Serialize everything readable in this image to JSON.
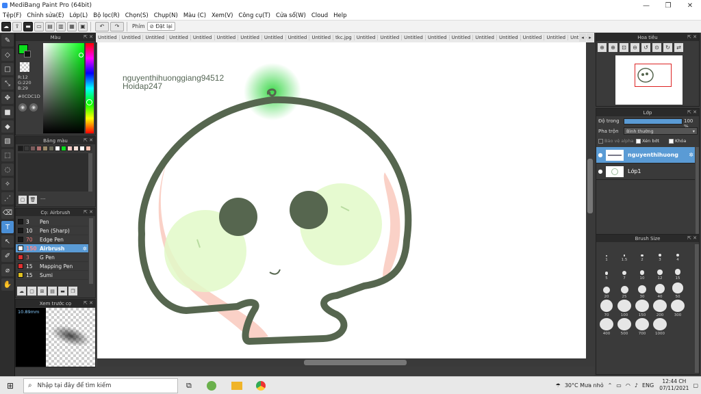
{
  "window": {
    "title": "MediBang Paint Pro (64bit)",
    "minimize": "—",
    "maximize": "❐",
    "close": "✕"
  },
  "menu": [
    "Tệp(F)",
    "Chỉnh sửa(E)",
    "Lớp(L)",
    "Bộ lọc(R)",
    "Chọn(S)",
    "Chụp(N)",
    "Màu (C)",
    "Xem(V)",
    "Công cụ(T)",
    "Cửa sổ(W)",
    "Cloud",
    "Help"
  ],
  "toolbar": {
    "snap_label": "Phím",
    "reset_label": "Đặt lại"
  },
  "tabs": [
    "Untitled",
    "Untitled",
    "Untitled",
    "Untitled",
    "Untitled",
    "Untitled",
    "Untitled",
    "Untitled",
    "Untitled",
    "Untitled",
    "tkc.jpg",
    "Untitled",
    "Untitled",
    "Untitled",
    "Untitled",
    "Untitled",
    "Untitled",
    "Untitled",
    "Untitled",
    "Untitled",
    "Untitled",
    "Untitled",
    "Untitled",
    "Untitled"
  ],
  "color_panel": {
    "title": "Màu",
    "r": "R:12",
    "g": "G:220",
    "b": "B:29",
    "hex": "#0CDC1D",
    "primary": "#0cdc1d"
  },
  "palette_panel": {
    "title": "Bảng màu",
    "swatches": [
      "#1a1a1a",
      "#3a3a3a",
      "#7a5c5c",
      "#b07070",
      "#9b8a6a",
      "#6a6a5a",
      "#ffffff",
      "#0cdc1d",
      "#f4c6c0",
      "#f6e0d8",
      "#ffffff",
      "#f8c0b0"
    ],
    "add_label": "---"
  },
  "brush_panel": {
    "title": "Cọ: Airbrush",
    "items": [
      {
        "size": "3",
        "name": "Pen",
        "color": "#1a1a1a"
      },
      {
        "size": "10",
        "name": "Pen (Sharp)",
        "color": "#1a1a1a"
      },
      {
        "size": "70",
        "name": "Edge Pen",
        "color": "#1a1a1a"
      },
      {
        "size": "150",
        "name": "Airbrush",
        "color": "#ffffff"
      },
      {
        "size": "3",
        "name": "G Pen",
        "color": "#e03030"
      },
      {
        "size": "15",
        "name": "Mapping Pen",
        "color": "#e03030"
      },
      {
        "size": "15",
        "name": "Sumi",
        "color": "#e0c020"
      }
    ]
  },
  "preview_panel": {
    "title": "Xem trước cọ",
    "size_label": "10.89mm"
  },
  "canvas_text": {
    "line1": "nguyenthihuonggiang94512",
    "line2": "Hoidap247"
  },
  "navigator": {
    "title": "Hoa tiêu"
  },
  "layer_panel": {
    "title": "Lớp",
    "opacity_label": "Độ trong",
    "opacity_value": "100 %",
    "opacity": 1.0,
    "blend_label": "Pha trộn",
    "blend_value": "Bình thường",
    "alpha_lock": "Bảo vệ alpha",
    "clipping": "Xén bớt",
    "lock": "Khóa",
    "layers": [
      {
        "name": "nguyenthihuong",
        "active": true
      },
      {
        "name": "Lớp1",
        "active": false
      }
    ]
  },
  "brush_size_panel": {
    "title": "Brush Size",
    "sizes": [
      "1",
      "1.5",
      "2",
      "3",
      "4",
      "5",
      "7",
      "10",
      "12",
      "15",
      "20",
      "25",
      "30",
      "40",
      "50",
      "70",
      "100",
      "150",
      "200",
      "300",
      "400",
      "500",
      "700",
      "1000"
    ]
  },
  "taskbar": {
    "search_placeholder": "Nhập tại đây để tìm kiếm",
    "weather": "30°C  Mưa nhỏ",
    "language": "ENG",
    "time": "12:44 CH",
    "date": "07/11/2021"
  }
}
